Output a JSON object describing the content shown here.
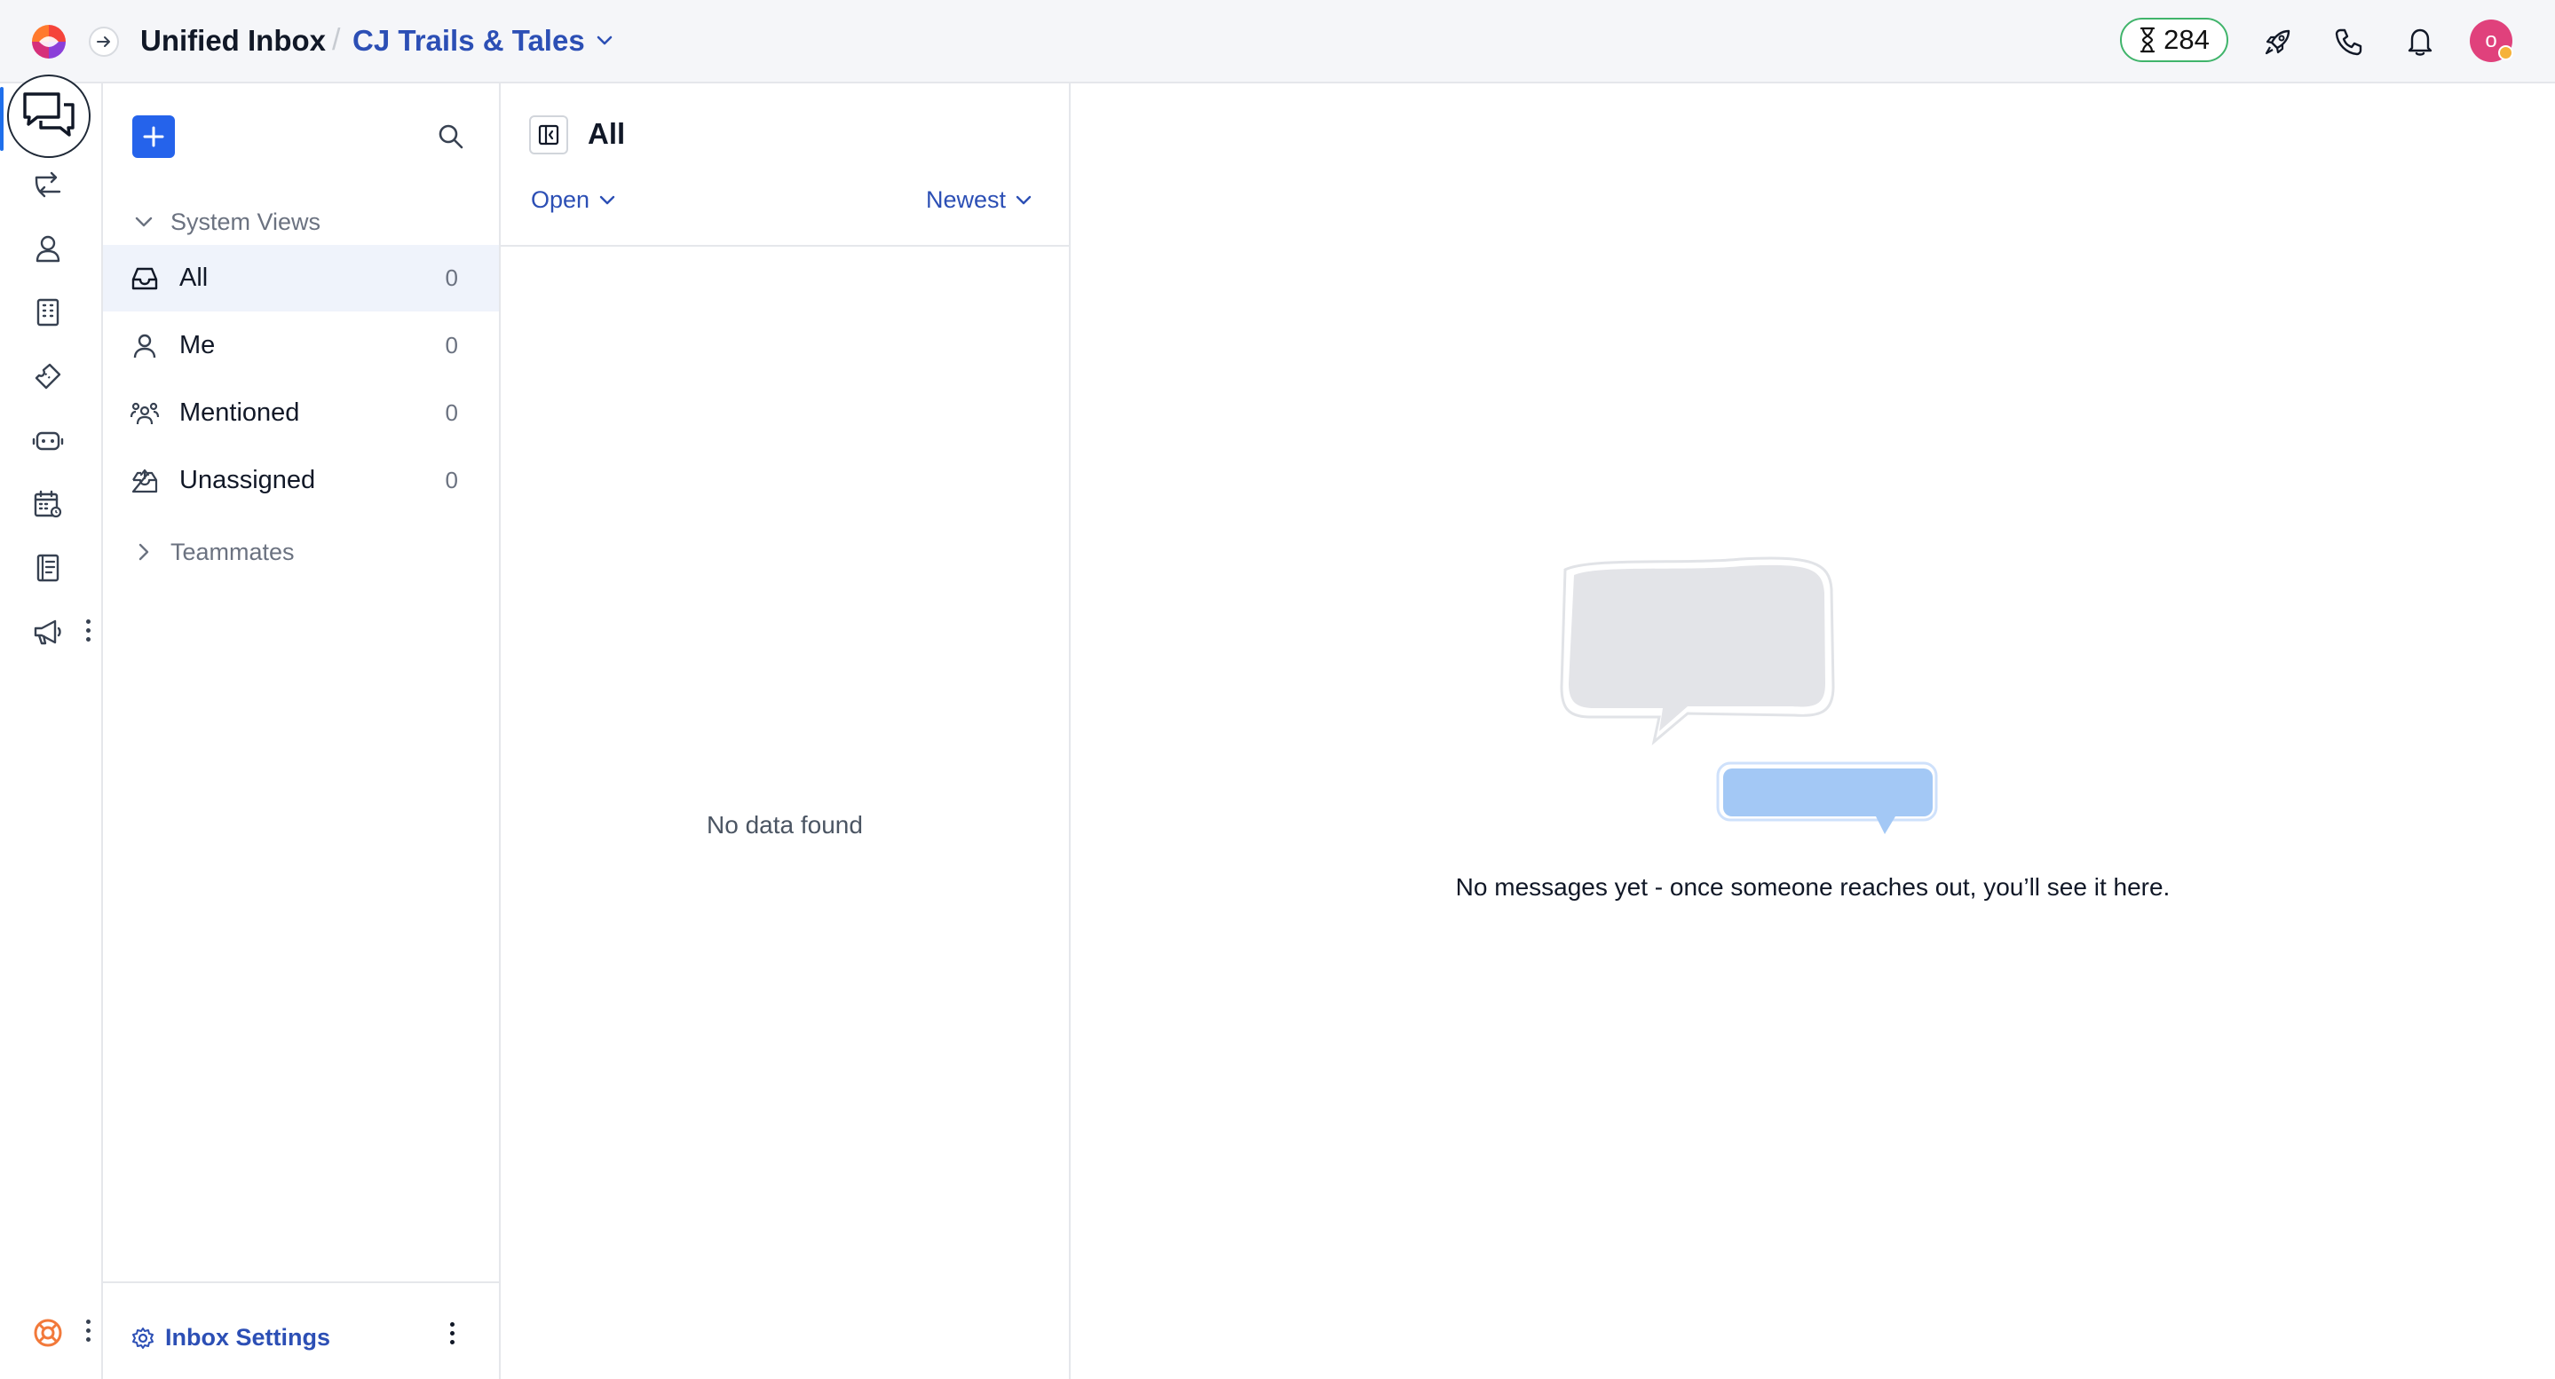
{
  "header": {
    "app_title": "Unified Inbox",
    "separator": "/",
    "workspace_name": "CJ Trails & Tales",
    "credits_count": "284",
    "avatar_initial": "o"
  },
  "rail": {
    "items": [
      "chat-icon",
      "routing-icon",
      "contacts-icon",
      "companies-icon",
      "tickets-icon",
      "bots-icon",
      "calendar-icon",
      "knowledge-icon",
      "campaigns-icon"
    ],
    "bottom_icon": "help-lifebuoy-icon"
  },
  "views": {
    "section_system": "System Views",
    "items": [
      {
        "label": "All",
        "count": "0",
        "icon": "inbox-icon"
      },
      {
        "label": "Me",
        "count": "0",
        "icon": "person-icon"
      },
      {
        "label": "Mentioned",
        "count": "0",
        "icon": "group-icon"
      },
      {
        "label": "Unassigned",
        "count": "0",
        "icon": "inbox-unassigned-icon"
      }
    ],
    "section_teammates": "Teammates",
    "footer_label": "Inbox Settings"
  },
  "list": {
    "title": "All",
    "status_filter": "Open",
    "sort_filter": "Newest",
    "empty_text": "No data found"
  },
  "detail": {
    "empty_message": "No messages yet - once someone reaches out, you’ll see it here."
  },
  "colors": {
    "accent": "#2563eb",
    "link": "#2c4fb5",
    "active_row": "#eff3fb",
    "credits_border": "#40b46b",
    "avatar": "#e0417c"
  }
}
